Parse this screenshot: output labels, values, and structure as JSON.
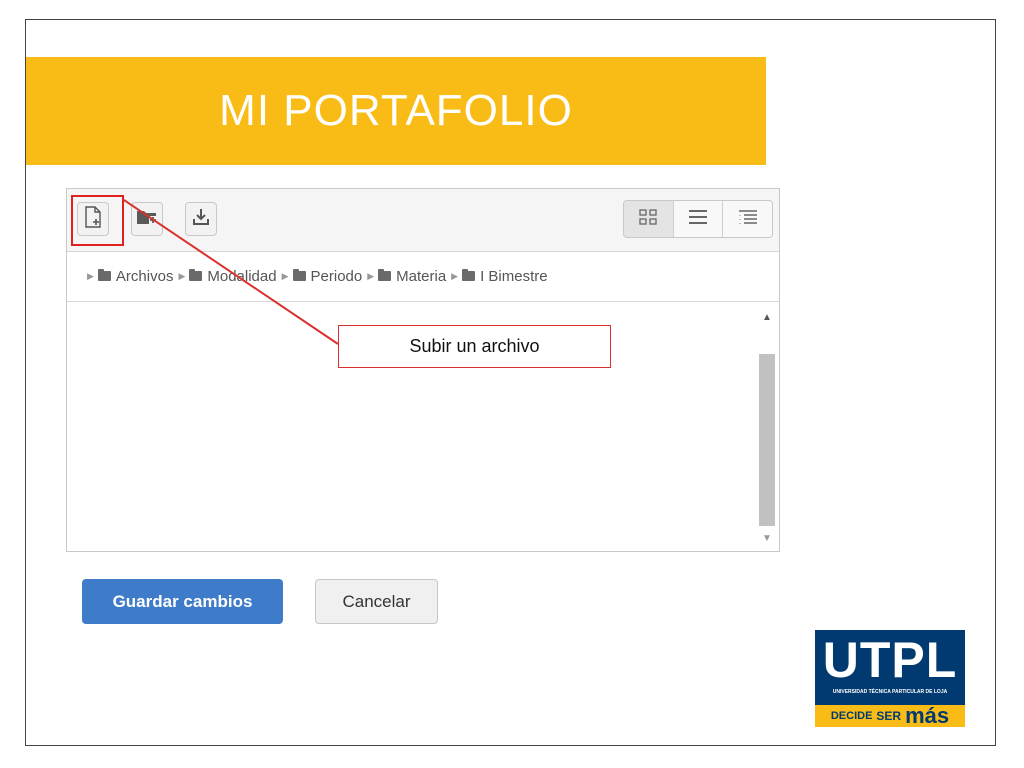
{
  "slide": {
    "title": "MI PORTAFOLIO"
  },
  "filemanager": {
    "toolbar": {
      "add_file_icon": "file-add-icon",
      "create_folder_icon": "folder-add-icon",
      "download_icon": "download-icon",
      "view_icons_icon": "grid-view-icon",
      "view_list_icon": "list-view-icon",
      "view_tree_icon": "tree-view-icon"
    },
    "breadcrumb": [
      {
        "label": "Archivos"
      },
      {
        "label": "Modalidad"
      },
      {
        "label": "Periodo"
      },
      {
        "label": "Materia"
      },
      {
        "label": "I Bimestre"
      }
    ]
  },
  "callout": {
    "text": "Subir un archivo",
    "color": "#d9302e"
  },
  "actions": {
    "save_label": "Guardar cambios",
    "cancel_label": "Cancelar"
  },
  "logo": {
    "name": "UTPL",
    "subtitle": "UNIVERSIDAD TÉCNICA PARTICULAR DE LOJA",
    "slogan_1": "DECIDE",
    "slogan_2": "SER",
    "slogan_3": "más"
  },
  "colors": {
    "banner": "#f9bc16",
    "primary_button": "#3e7bc8",
    "logo_blue": "#003a70"
  }
}
